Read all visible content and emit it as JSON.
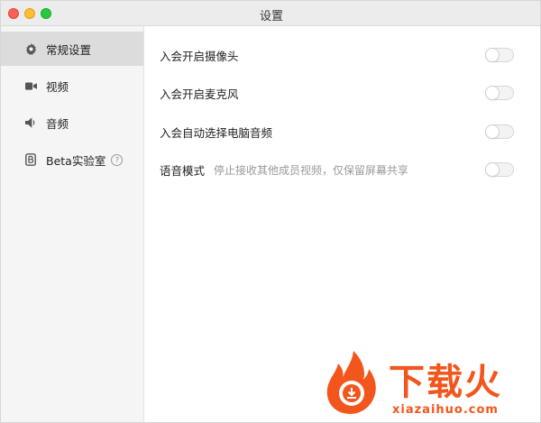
{
  "window": {
    "title": "设置"
  },
  "sidebar": {
    "items": [
      {
        "label": "常规设置",
        "icon": "gear-icon",
        "active": true
      },
      {
        "label": "视频",
        "icon": "video-camera-icon",
        "active": false
      },
      {
        "label": "音频",
        "icon": "speaker-icon",
        "active": false
      },
      {
        "label": "Beta实验室",
        "icon": "beta-lab-icon",
        "active": false,
        "help_icon": "question-circle-icon",
        "help_glyph": "?"
      }
    ]
  },
  "settings": [
    {
      "label": "入会开启摄像头",
      "enabled": false
    },
    {
      "label": "入会开启麦克风",
      "enabled": false
    },
    {
      "label": "入会自动选择电脑音频",
      "enabled": false
    },
    {
      "label": "语音模式",
      "description": "停止接收其他成员视频，仅保留屏幕共享",
      "enabled": false
    }
  ],
  "watermark": {
    "brand": "下载火",
    "url": "xiazaihuo.com"
  },
  "colors": {
    "watermark": "#f2561d",
    "sidebar_active": "#dcdcdc"
  }
}
